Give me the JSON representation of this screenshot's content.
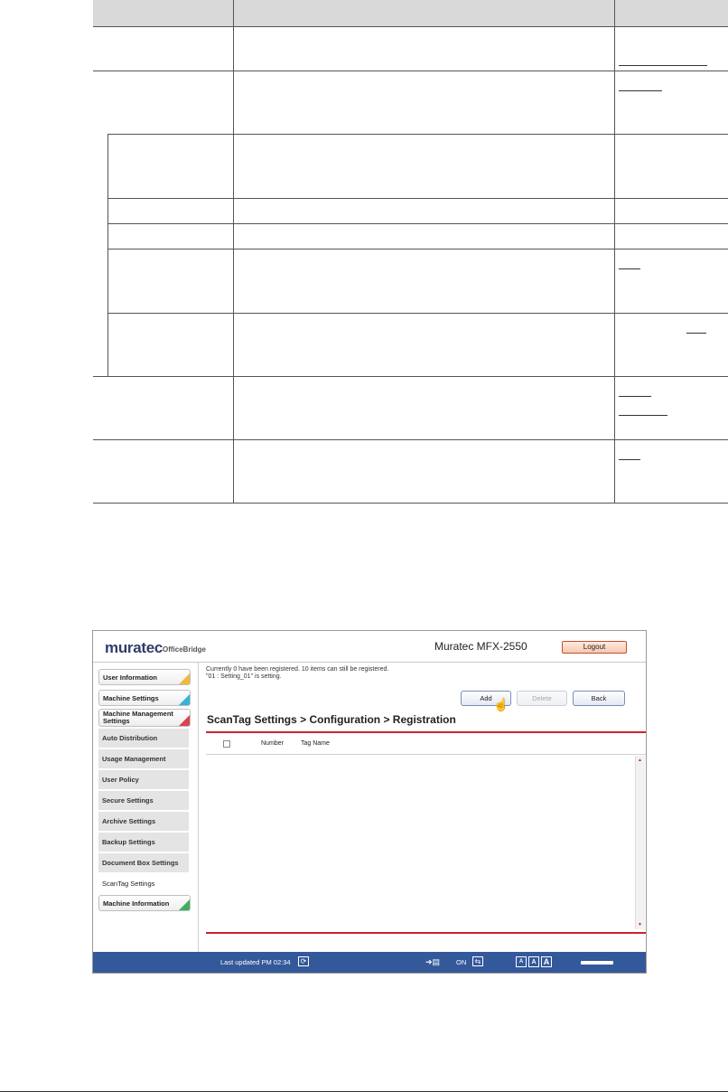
{
  "window": {
    "brand": "muratec",
    "product": "OfficeBridge",
    "model": "Muratec MFX-2550",
    "logout_label": "Logout"
  },
  "sidebar": {
    "tabs": [
      {
        "label": "User Information",
        "color": "#f0b93a"
      },
      {
        "label": "Machine Settings",
        "color": "#36b3d6"
      },
      {
        "label": "Machine Management Settings",
        "color": "#d9454e"
      },
      {
        "label": "Machine Information",
        "color": "#3fae5f"
      }
    ],
    "sub_items": [
      "Auto Distribution",
      "Usage Management",
      "User Policy",
      "Secure Settings",
      "Archive Settings",
      "Backup Settings",
      "Document Box Settings",
      "ScanTag Settings"
    ],
    "active_sub_item": "ScanTag Settings"
  },
  "main": {
    "info_line1": "Currently 0 have been registered. 10 items can still be registered.",
    "info_line2": "\"01 : Setting_01\" is setting.",
    "buttons": {
      "add": "Add",
      "delete": "Delete",
      "back": "Back"
    },
    "breadcrumb": "ScanTag Settings > Configuration > Registration",
    "columns": [
      "Number",
      "Tag Name"
    ],
    "rows": []
  },
  "footer": {
    "last_updated": "Last updated PM 02:34",
    "status": "ON",
    "font_sizes": [
      "A",
      "A",
      "A"
    ]
  },
  "colors": {
    "accent_red": "#c8252b",
    "footer_blue": "#34599a"
  }
}
